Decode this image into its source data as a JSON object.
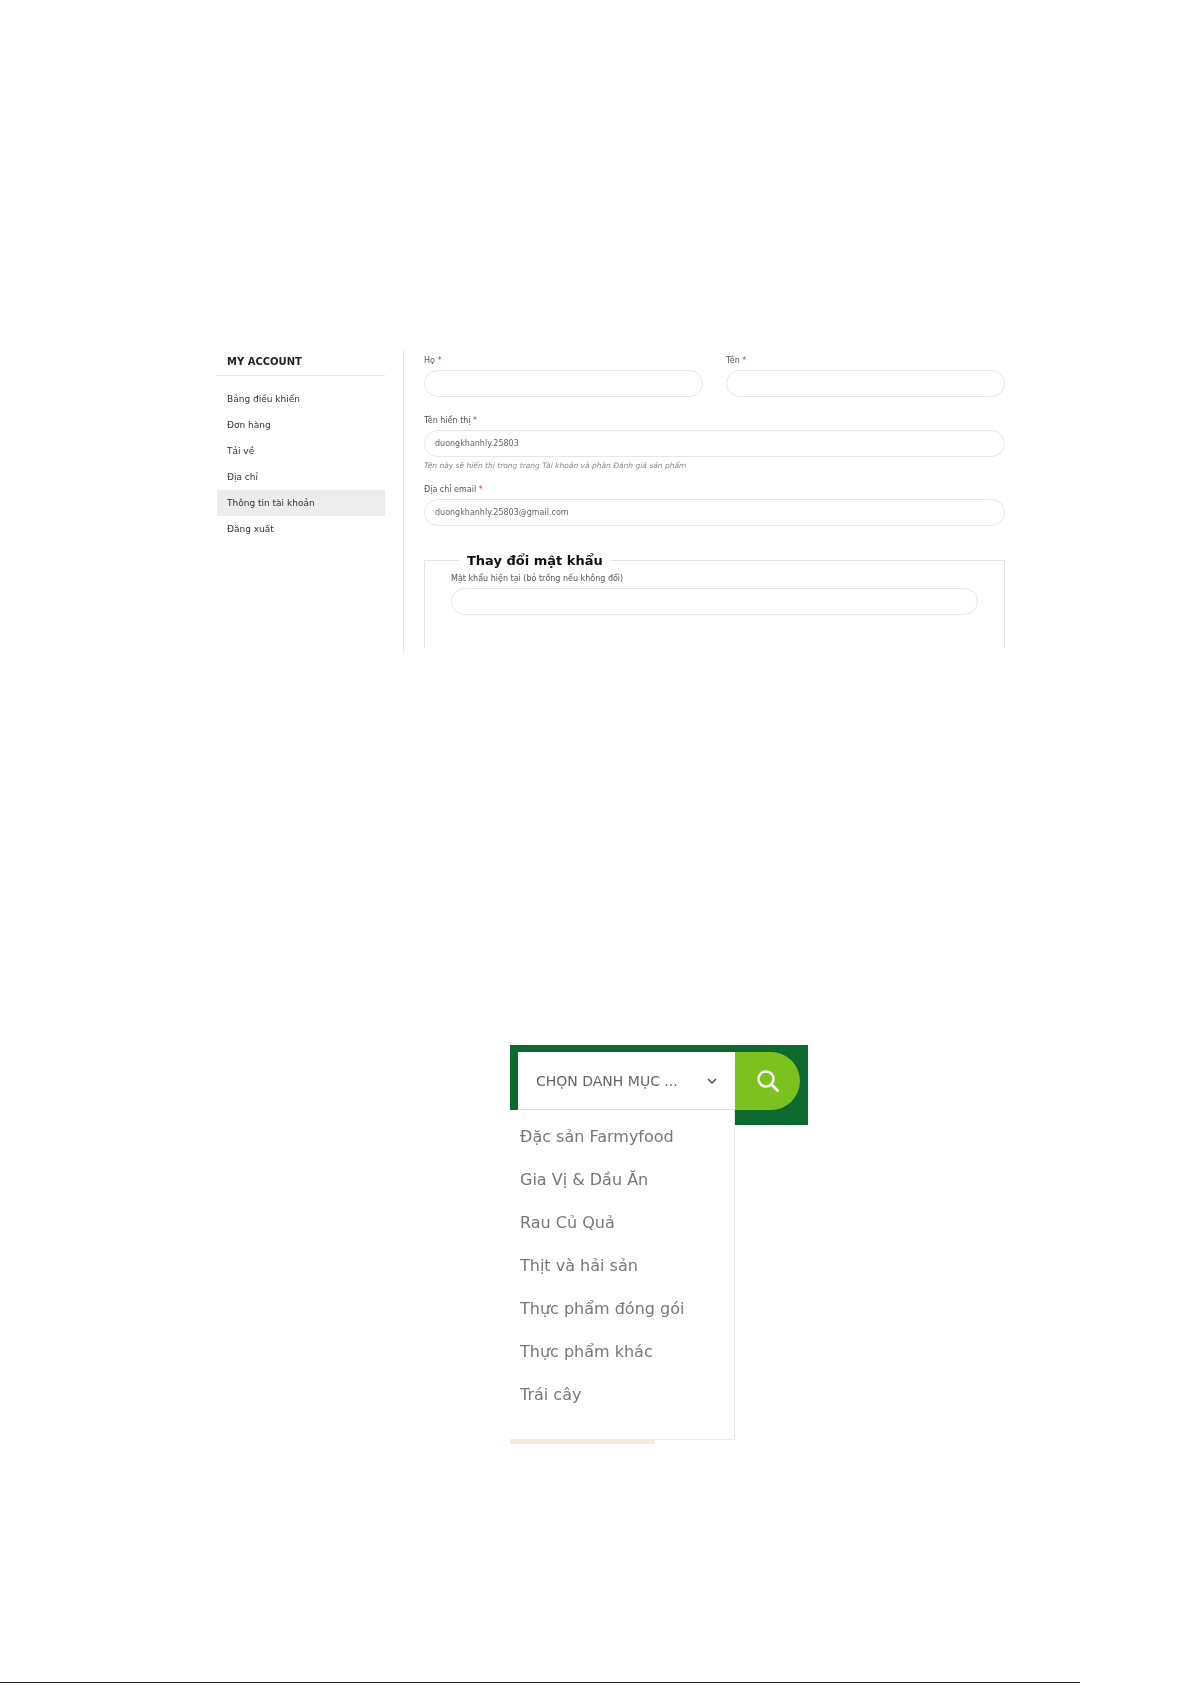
{
  "account": {
    "sidebar": {
      "title": "MY ACCOUNT",
      "items": [
        {
          "label": "Bảng điều khiển",
          "selected": false
        },
        {
          "label": "Đơn hàng",
          "selected": false
        },
        {
          "label": "Tải về",
          "selected": false
        },
        {
          "label": "Địa chỉ",
          "selected": false
        },
        {
          "label": "Thông tin tài khoản",
          "selected": true
        },
        {
          "label": "Đăng xuất",
          "selected": false
        }
      ]
    },
    "name_fields": [
      {
        "label": "Họ",
        "required_mark": "*"
      },
      {
        "label": "Tên",
        "required_mark": "*"
      }
    ],
    "fields": [
      {
        "label": "Tên hiển thị",
        "required_mark": "*",
        "value": "duongkhanhly.25803",
        "hint": "Tên này sẽ hiển thị trong trang Tài khoản và phần Đánh giá sản phẩm"
      },
      {
        "label": "Địa chỉ email",
        "required_mark": "*",
        "value": "duongkhanhly.25803@gmail.com"
      }
    ],
    "password_section": {
      "legend": "Thay đổi mật khẩu",
      "fields": [
        {
          "label": "Mật khẩu hiện tại (bỏ trống nếu không đổi)"
        }
      ]
    }
  },
  "category_search": {
    "select": {
      "value": "CHỌN DANH MỤC ..."
    },
    "items": [
      "Đặc sản Farmyfood",
      "Gia Vị & Dầu Ăn",
      "Rau Củ Quả",
      "Thịt và hải sản",
      "Thực phẩm đóng gói",
      "Thực phẩm khác",
      "Trái cây"
    ]
  }
}
